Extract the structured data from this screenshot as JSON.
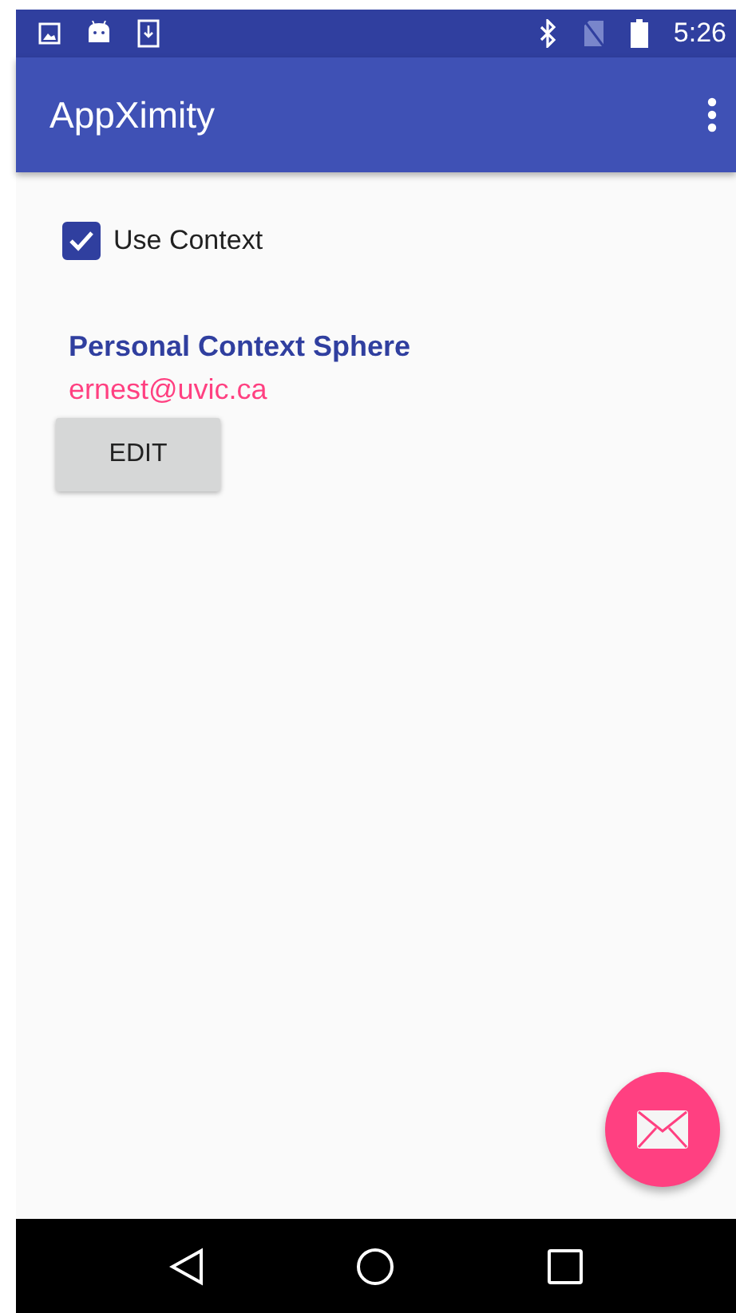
{
  "status_bar": {
    "time": "5:26"
  },
  "app_bar": {
    "title": "AppXimity"
  },
  "use_context": {
    "label": "Use Context",
    "checked": true
  },
  "sphere": {
    "heading": "Personal Context Sphere",
    "email": "ernest@uvic.ca",
    "button": "EDIT"
  }
}
